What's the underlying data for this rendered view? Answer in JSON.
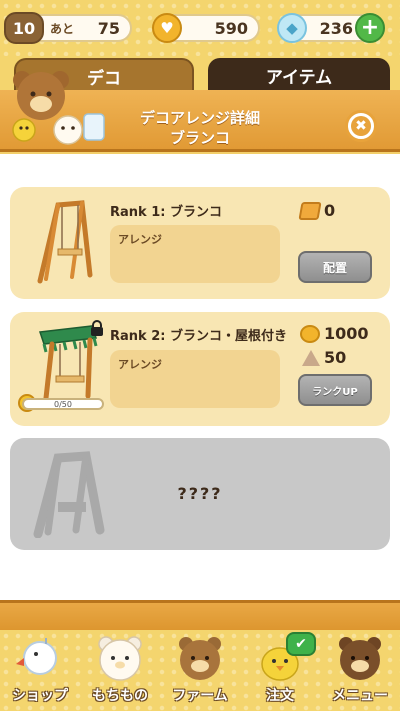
{
  "status_bar": {
    "level": "10",
    "remaining_label": "あと",
    "remaining_value": "75",
    "coins": "590",
    "gems": "236",
    "plus_symbol": "+"
  },
  "tabs": [
    {
      "label": "デコ",
      "active": false
    },
    {
      "label": "アイテム",
      "active": true
    }
  ],
  "header": {
    "title_line1": "デコアレンジ詳細",
    "title_line2": "ブランコ",
    "close_symbol": "✖"
  },
  "ranks": [
    {
      "title": "Rank 1: ブランコ",
      "arrange_label": "アレンジ",
      "cost_wood": "0",
      "button_label": "配置"
    },
    {
      "title": "Rank 2: ブランコ・屋根付き",
      "arrange_label": "アレンジ",
      "cost_coin": "1000",
      "cost_material": "50",
      "button_label": "ランクUP",
      "progress_text": "0/50",
      "progress_fraction": 0,
      "locked": true
    },
    {
      "title": "????",
      "locked": true
    }
  ],
  "nav": [
    {
      "label": "ショップ",
      "icon": "chick-character-icon"
    },
    {
      "label": "もちもの",
      "icon": "white-bear-icon"
    },
    {
      "label": "ファーム",
      "icon": "brown-bear-icon"
    },
    {
      "label": "注文",
      "icon": "yellow-bird-icon",
      "badge": "✔"
    },
    {
      "label": "メニュー",
      "icon": "bear-face-icon"
    }
  ],
  "colors": {
    "accent_orange": "#e8a33b",
    "wood": "#e19a35",
    "card_bg": "#f8e6b3",
    "locked_card": "#c8c8c8",
    "button_grey": "#9e9e9e",
    "check_green": "#3eb24a"
  }
}
